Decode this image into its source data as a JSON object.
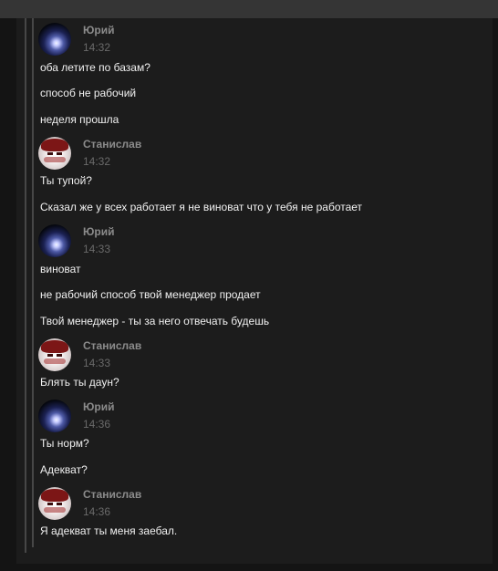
{
  "chat": {
    "groups": [
      {
        "author": "Юрий",
        "time": "14:32",
        "messages": [
          "оба летите по базам?",
          "способ не рабочий",
          "неделя прошла"
        ]
      },
      {
        "author": "Станислав",
        "time": "14:32",
        "messages": [
          "Ты тупой?",
          "Сказал же у всех работает я не виноват что у тебя не работает"
        ]
      },
      {
        "author": "Юрий",
        "time": "14:33",
        "messages": [
          "виноват",
          "не рабочий способ твой менеджер продает",
          "Твой менеджер - ты за него отвечать будешь"
        ]
      },
      {
        "author": "Станислав",
        "time": "14:33",
        "messages": [
          "Блять ты даун?"
        ]
      },
      {
        "author": "Юрий",
        "time": "14:36",
        "messages": [
          "Ты норм?",
          "Адекват?"
        ]
      },
      {
        "author": "Станислав",
        "time": "14:36",
        "messages": [
          "Я адекват ты меня заебал."
        ]
      }
    ]
  }
}
